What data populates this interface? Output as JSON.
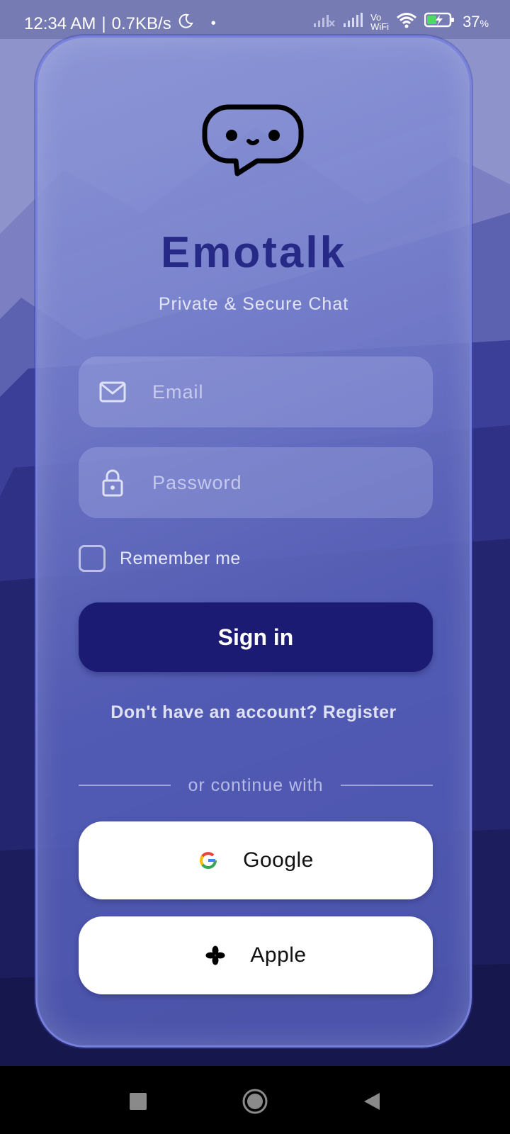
{
  "status_bar": {
    "time": "12:34 AM",
    "speed": "0.7KB/s",
    "battery_percent": "37",
    "battery_unit": "%",
    "network_label_top": "Vo",
    "network_label_bottom": "WiFi"
  },
  "app": {
    "title": "Emotalk",
    "tagline": "Private & Secure Chat"
  },
  "form": {
    "email_placeholder": "Email",
    "password_placeholder": "Password",
    "remember_label": "Remember me",
    "remember_checked": false,
    "signin_label": "Sign in"
  },
  "register_text": "Don't have an account? Register",
  "divider_text": "or continue with",
  "social": {
    "google_label": "Google",
    "apple_label": "Apple"
  },
  "colors": {
    "primary": "#1b1b74",
    "title": "#262a86"
  }
}
